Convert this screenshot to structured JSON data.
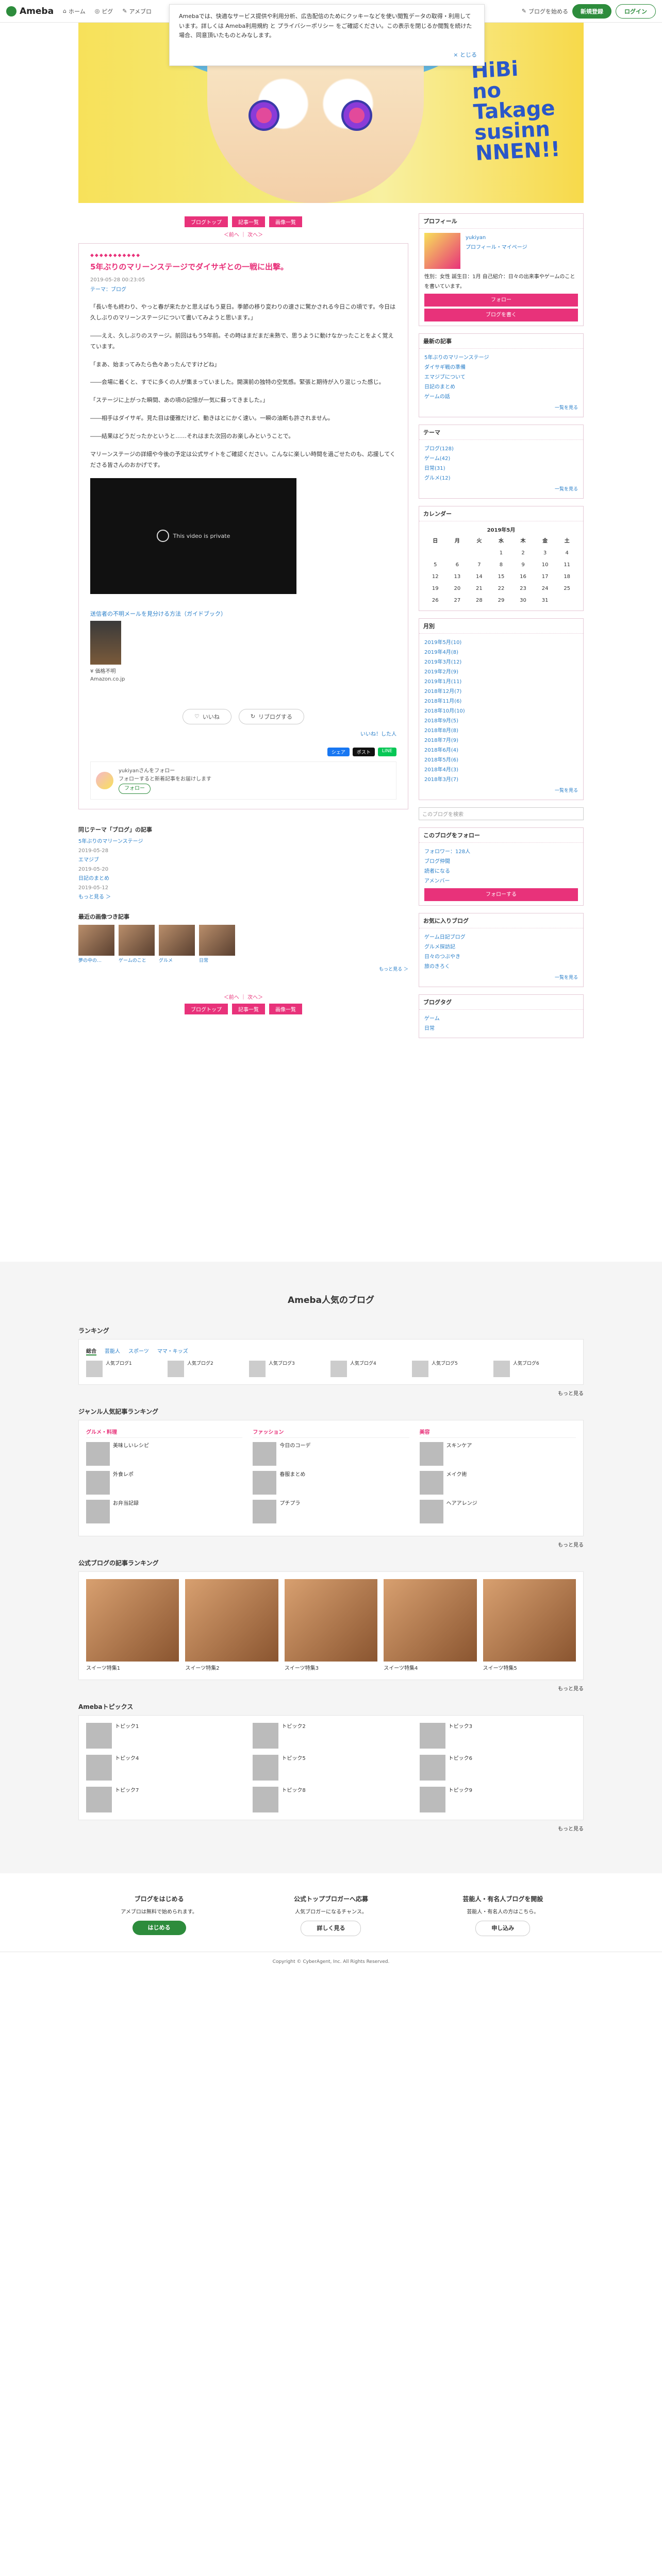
{
  "header": {
    "logo": "Ameba",
    "nav": [
      "ホーム",
      "ピグ",
      "アメブロ"
    ],
    "login_label": "ログイン",
    "register_label": "新規登録",
    "blog_start_label": "ブログを始める"
  },
  "notice": {
    "text": "Amebaでは、快適なサービス提供や利用分析、広告配信のためにクッキーなどを使い閲覧データの取得・利用しています。詳しくは Ameba利用規約 と プライバシーポリシー をご確認ください。この表示を閉じるか閲覧を続けた場合、同意頂いたものとみなします。",
    "close_label": "とじる"
  },
  "banner": {
    "line1": "HiBi",
    "line2": "no",
    "line3": "Takage",
    "line4": "susinn",
    "line5": "NNEN!!"
  },
  "pager": {
    "prev_label": "ブログトップ",
    "list_label": "記事一覧",
    "img_label": "画像一覧",
    "prev_article": "＜前へ",
    "next_article": "次へ＞"
  },
  "article": {
    "deco": "◆◆◆◆◆◆◆◆◆◆◆",
    "title": "5年ぶりのマリーンステージでダイサギとの一戦に出撃。",
    "date": "2019-05-28 00:23:05",
    "theme": "テーマ：ブログ",
    "paragraphs": [
      "「長い冬も終わり、やっと春が来たかと思えばもう夏日。季節の移り変わりの速さに驚かされる今日この頃です。今日は久しぶりのマリーンステージについて書いてみようと思います。」",
      "――ええ、久しぶりのステージ。前回はもう5年前。その時はまだまだ未熟で、思うように動けなかったことをよく覚えています。",
      "「まあ、始まってみたら色々あったんですけどね」",
      "――会場に着くと、すでに多くの人が集まっていました。開演前の独特の空気感。緊張と期待が入り混じった感じ。",
      "「ステージに上がった瞬間、あの頃の記憶が一気に蘇ってきました。」",
      "――相手はダイサギ。見た目は優雅だけど、動きはとにかく速い。一瞬の油断も許されません。",
      "――結果はどうだったかというと……それはまた次回のお楽しみということで。",
      "マリーンステージの詳細や今後の予定は公式サイトをご確認ください。こんなに楽しい時間を過ごせたのも、応援してくださる皆さんのおかげです。"
    ],
    "video_text": "This video is private",
    "amazon_link": "送信者の不明メールを見分ける方法（ガイドブック）",
    "amazon_sub1": "¥ 価格不明",
    "amazon_sub2": "Amazon.co.jp",
    "like_label": "いいね",
    "reblog_label": "リブログする",
    "like_sub": "いいね！した人",
    "share_fb": "シェア",
    "share_x": "ポスト",
    "share_line": "LINE",
    "follow_name": "yukiyanさんをフォロー",
    "follow_sub": "フォローすると新着記事をお届けします",
    "follow_btn": "フォロー"
  },
  "related": {
    "heading": "同じテーマ「ブログ」の記事",
    "items": [
      {
        "title": "5年ぶりのマリーンステージ",
        "date": "2019-05-28"
      },
      {
        "title": "エマジブ",
        "date": "2019-05-20"
      },
      {
        "title": "日記のまとめ",
        "date": "2019-05-12"
      }
    ],
    "more": "もっと見る ＞"
  },
  "recent": {
    "heading": "最近の画像つき記事",
    "more": "もっと見る ＞",
    "thumbs": [
      "夢の中の…",
      "ゲームのこと",
      "グルメ",
      "日常"
    ]
  },
  "side": {
    "profile_h": "プロフィール",
    "profile_name": "yukiyan",
    "profile_sub": "プロフィール・マイページ",
    "profile_text": "性別：女性 誕生日：1月 自己紹介：日々の出来事やゲームのことを書いています。",
    "profile_btn1": "フォロー",
    "profile_btn2": "ブログを書く",
    "popular_h": "最新の記事",
    "popular_items": [
      "5年ぶりのマリーンステージ",
      "ダイサギ戦の準備",
      "エマジブについて",
      "日記のまとめ",
      "ゲームの話"
    ],
    "popular_more": "一覧を見る",
    "theme_h": "テーマ",
    "theme_items": [
      "ブログ(128)",
      "ゲーム(42)",
      "日常(31)",
      "グルメ(12)"
    ],
    "theme_more": "一覧を見る",
    "cal_h": "カレンダー",
    "cal_month": "2019年5月",
    "cal_weekdays": [
      "日",
      "月",
      "火",
      "水",
      "木",
      "金",
      "土"
    ],
    "cal_rows": [
      [
        "",
        "",
        "",
        "1",
        "2",
        "3",
        "4"
      ],
      [
        "5",
        "6",
        "7",
        "8",
        "9",
        "10",
        "11"
      ],
      [
        "12",
        "13",
        "14",
        "15",
        "16",
        "17",
        "18"
      ],
      [
        "19",
        "20",
        "21",
        "22",
        "23",
        "24",
        "25"
      ],
      [
        "26",
        "27",
        "28",
        "29",
        "30",
        "31",
        ""
      ]
    ],
    "archive_h": "月別",
    "archive_items": [
      "2019年5月(10)",
      "2019年4月(8)",
      "2019年3月(12)",
      "2019年2月(9)",
      "2019年1月(11)",
      "2018年12月(7)",
      "2018年11月(6)",
      "2018年10月(10)",
      "2018年9月(5)",
      "2018年8月(8)",
      "2018年7月(9)",
      "2018年6月(4)",
      "2018年5月(6)",
      "2018年4月(3)",
      "2018年3月(7)"
    ],
    "archive_more": "一覧を見る",
    "search_ph": "このブログを検索",
    "follow_h": "このブログをフォロー",
    "follow_items": [
      "フォロワー：128人",
      "ブログ仲間",
      "読者になる",
      "アメンバー"
    ],
    "follow_more": "フォローする",
    "friends_h": "お気に入りブログ",
    "friends_items": [
      "ゲーム日記ブログ",
      "グルメ探訪記",
      "日々のつぶやき",
      "旅のきろく"
    ],
    "friends_more": "一覧を見る",
    "tag_h": "ブログタグ",
    "tag_items": [
      "ゲーム",
      "日常"
    ]
  },
  "popular": {
    "title": "Ameba人気のブログ",
    "ranking_h": "ランキング",
    "ranking_tabs": [
      "総合",
      "芸能人",
      "スポーツ",
      "ママ・キッズ"
    ],
    "ranking_items": [
      "人気ブログ1",
      "人気ブログ2",
      "人気ブログ3",
      "人気ブログ4",
      "人気ブログ5",
      "人気ブログ6"
    ],
    "more": "もっと見る",
    "genre_h": "ジャンル人気記事ランキング",
    "genre_cols": [
      {
        "name": "グルメ・料理",
        "items": [
          "美味しいレシピ",
          "外食レポ",
          "お弁当記録"
        ]
      },
      {
        "name": "ファッション",
        "items": [
          "今日のコーデ",
          "春服まとめ",
          "プチプラ"
        ]
      },
      {
        "name": "美容",
        "items": [
          "スキンケア",
          "メイク術",
          "ヘアアレンジ"
        ]
      }
    ],
    "sweets_h": "公式ブログの記事ランキング",
    "sweets_items": [
      "スイーツ特集1",
      "スイーツ特集2",
      "スイーツ特集3",
      "スイーツ特集4",
      "スイーツ特集5"
    ],
    "topics_h": "Amebaトピックス",
    "topics_items": [
      "トピック1",
      "トピック2",
      "トピック3",
      "トピック4",
      "トピック5",
      "トピック6",
      "トピック7",
      "トピック8",
      "トピック9"
    ]
  },
  "cta": [
    {
      "title": "ブログをはじめる",
      "text": "アメブロは無料で始められます。",
      "btn": "はじめる"
    },
    {
      "title": "公式トップブロガーへ応募",
      "text": "人気ブロガーになるチャンス。",
      "btn": "詳しく見る"
    },
    {
      "title": "芸能人・有名人ブログを開設",
      "text": "芸能人・有名人の方はこちら。",
      "btn": "申し込み"
    }
  ],
  "footer": {
    "copyright": "Copyright © CyberAgent, Inc. All Rights Reserved."
  }
}
